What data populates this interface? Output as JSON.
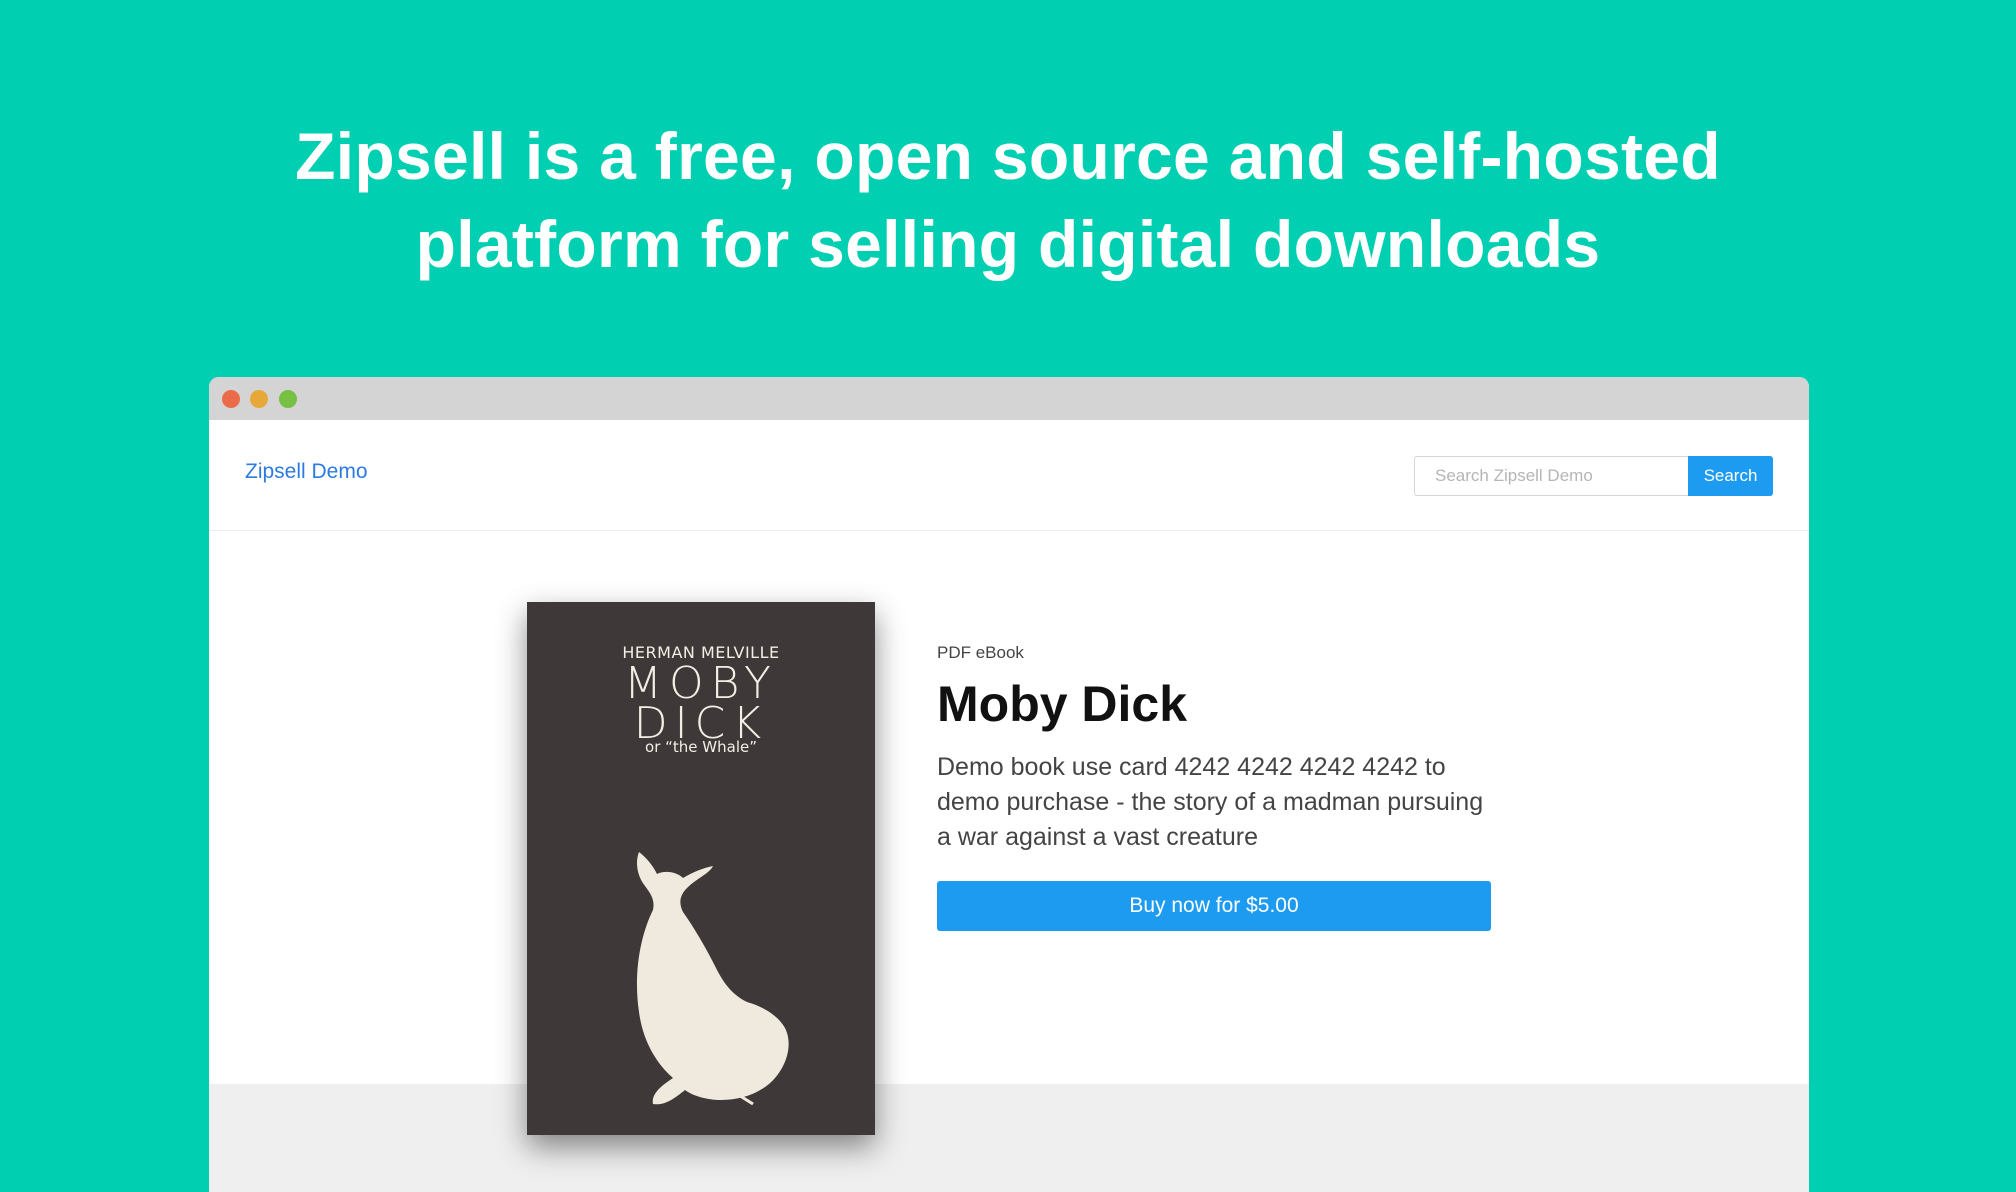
{
  "headline": {
    "line1": "Zipsell is a free, open source and self-hosted",
    "line2": "platform for selling digital downloads"
  },
  "navbar": {
    "brand": "Zipsell Demo",
    "search_placeholder": "Search Zipsell Demo",
    "search_button": "Search"
  },
  "product": {
    "type_label": "PDF eBook",
    "title": "Moby Dick",
    "description": "Demo book use card 4242 4242 4242 4242 to demo purchase - the story of a madman pursuing a war against a vast creature",
    "buy_label": "Buy now for $5.00",
    "cover": {
      "author": "HERMAN MELVILLE",
      "title_line1": "MOBY",
      "title_line2": "DICK",
      "subtitle": "or “the Whale”"
    }
  },
  "colors": {
    "background": "#00d0b1",
    "accent": "#1d9bf0",
    "brand_link": "#2d7be0",
    "cover": "#3f3838"
  }
}
